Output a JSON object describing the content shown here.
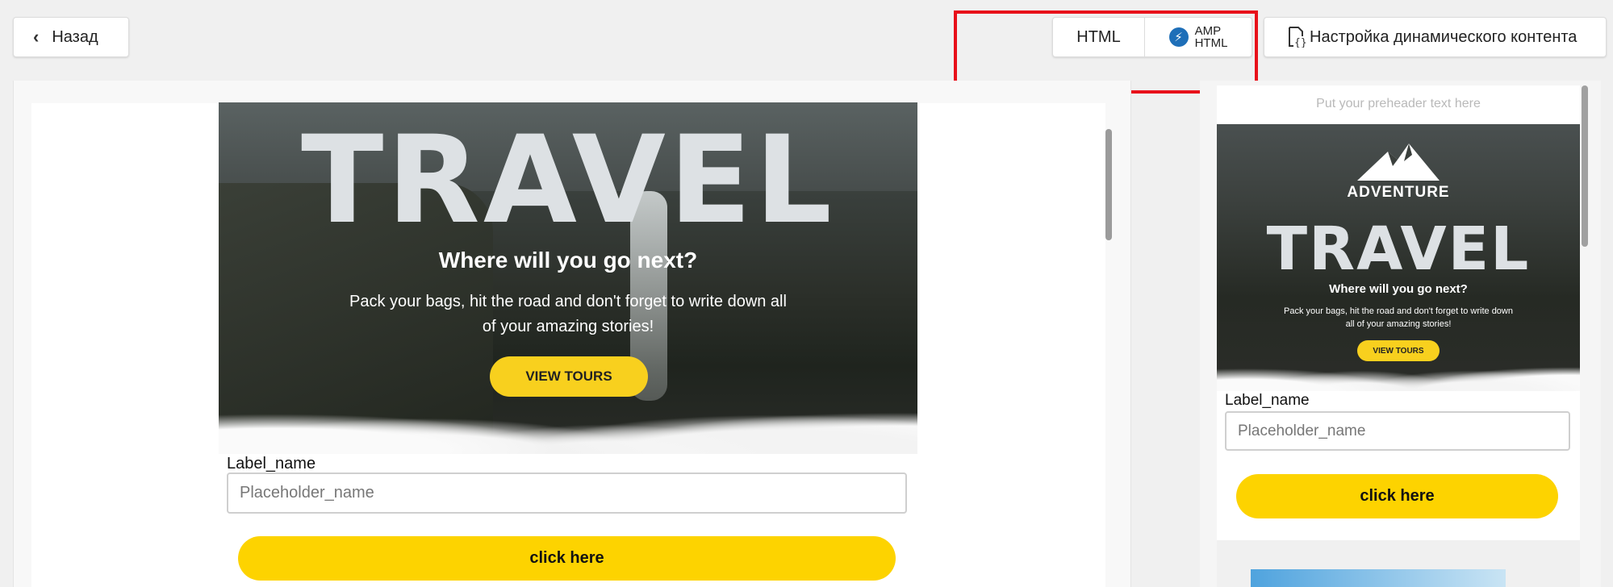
{
  "toolbar": {
    "back_label": "Назад",
    "mode_html": "HTML",
    "mode_amp_line1": "AMP",
    "mode_amp_line2": "HTML",
    "dynamic_content_label": "Настройка динамического контента"
  },
  "editor": {
    "hero": {
      "title": "TRAVEL",
      "subtitle": "Where will you go next?",
      "description": "Pack your bags, hit the road and don't forget to write down all of your amazing stories!",
      "cta": "VIEW TOURS"
    },
    "form": {
      "label": "Label_name",
      "placeholder": "Placeholder_name",
      "button": "click here"
    }
  },
  "preview": {
    "preheader": "Put your preheader text here",
    "hero": {
      "brand": "ADVENTURE",
      "title": "TRAVEL",
      "subtitle": "Where will you go next?",
      "description": "Pack your bags, hit the road and don't forget to write down all of your amazing stories!",
      "cta": "VIEW TOURS"
    },
    "form": {
      "label": "Label_name",
      "placeholder": "Placeholder_name",
      "button": "click here"
    }
  },
  "colors": {
    "accent_yellow": "#fdd300",
    "highlight_red": "#e8101a",
    "amp_blue": "#1e6fb8"
  },
  "icons": [
    "chevron-left-icon",
    "amp-lightning-icon",
    "document-braces-icon",
    "mountain-logo-icon"
  ]
}
